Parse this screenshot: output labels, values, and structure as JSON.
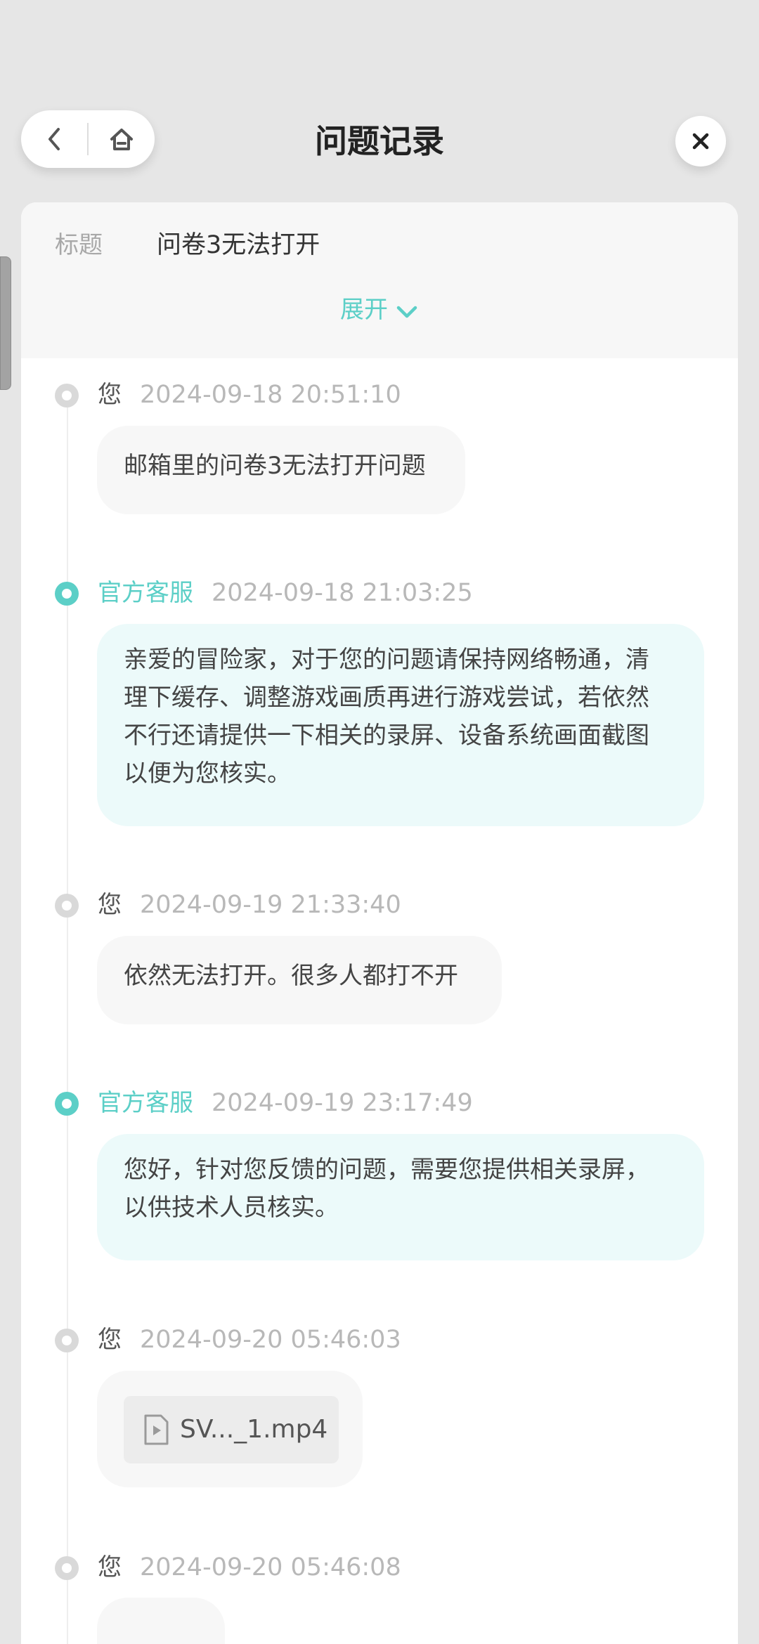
{
  "header": {
    "title": "问题记录",
    "back_icon": "chevron-left-icon",
    "home_icon": "home-icon",
    "close_icon": "close-icon"
  },
  "ticket": {
    "title_label": "标题",
    "title_value": "问卷3无法打开",
    "expand_label": "展开"
  },
  "colors": {
    "accent": "#5ccfc7",
    "official_bubble": "#ecfafa",
    "user_bubble": "#f7f7f7",
    "background": "#e6e6e6"
  },
  "messages": [
    {
      "sender": "您",
      "time": "2024-09-18 20:51:10",
      "text": "邮箱里的问卷3无法打开问题"
    },
    {
      "sender": "官方客服",
      "time": "2024-09-18 21:03:25",
      "lines": [
        "亲爱的冒险家，对于您的问题请保持网络畅通，清",
        "理下缓存、调整游戏画质再进行游戏尝试，若依然",
        "不行还请提供一下相关的录屏、设备系统画面截图",
        "以便为您核实。"
      ]
    },
    {
      "sender": "您",
      "time": "2024-09-19 21:33:40",
      "text": "依然无法打开。很多人都打不开"
    },
    {
      "sender": "官方客服",
      "time": "2024-09-19 23:17:49",
      "lines": [
        "您好，针对您反馈的问题，需要您提供相关录屏，",
        "以供技术人员核实。"
      ]
    },
    {
      "sender": "您",
      "time": "2024-09-20 05:46:03",
      "attachment": {
        "file_name": "SV..._1.mp4",
        "icon": "video-file-icon"
      }
    },
    {
      "sender": "您",
      "time": "2024-09-20 05:46:08"
    }
  ]
}
